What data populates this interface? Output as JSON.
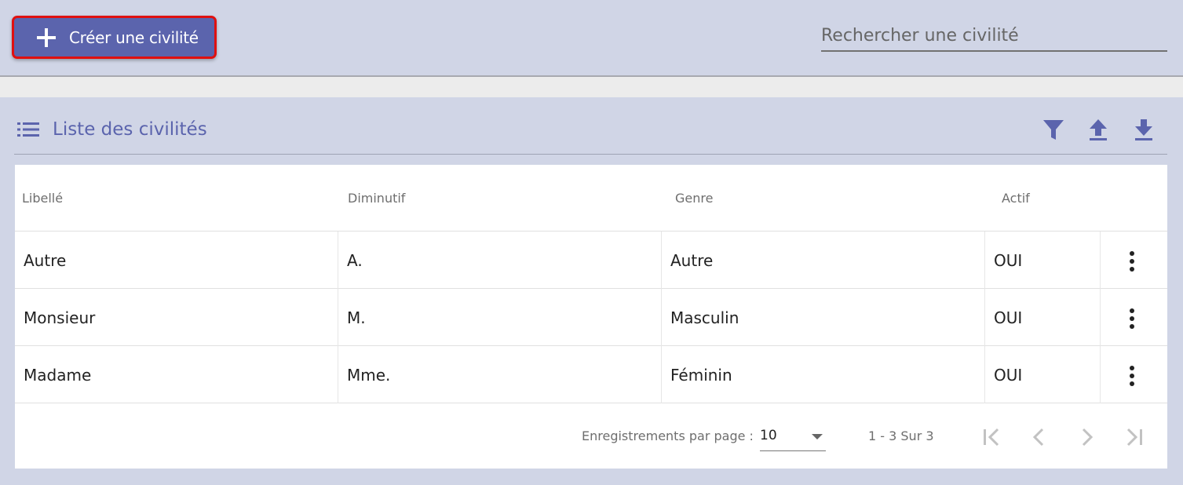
{
  "toolbar": {
    "create_label": "Créer une civilité",
    "search_placeholder": "Rechercher une civilité"
  },
  "section": {
    "title": "Liste des civilités",
    "icons": {
      "list": "list-icon",
      "filter": "filter-icon",
      "upload": "upload-icon",
      "download": "download-icon"
    }
  },
  "table": {
    "columns": [
      "Libellé",
      "Diminutif",
      "Genre",
      "Actif"
    ],
    "rows": [
      [
        "Autre",
        "A.",
        "Autre",
        "OUI"
      ],
      [
        "Monsieur",
        "M.",
        "Masculin",
        "OUI"
      ],
      [
        "Madame",
        "Mme.",
        "Féminin",
        "OUI"
      ]
    ]
  },
  "pagination": {
    "page_size_label": "Enregistrements par page :",
    "page_size_value": "10",
    "range_label": "1 - 3 Sur 3"
  },
  "colors": {
    "accent": "#5b64ad",
    "background": "#d0d5e6",
    "highlight_border": "#e01010"
  }
}
